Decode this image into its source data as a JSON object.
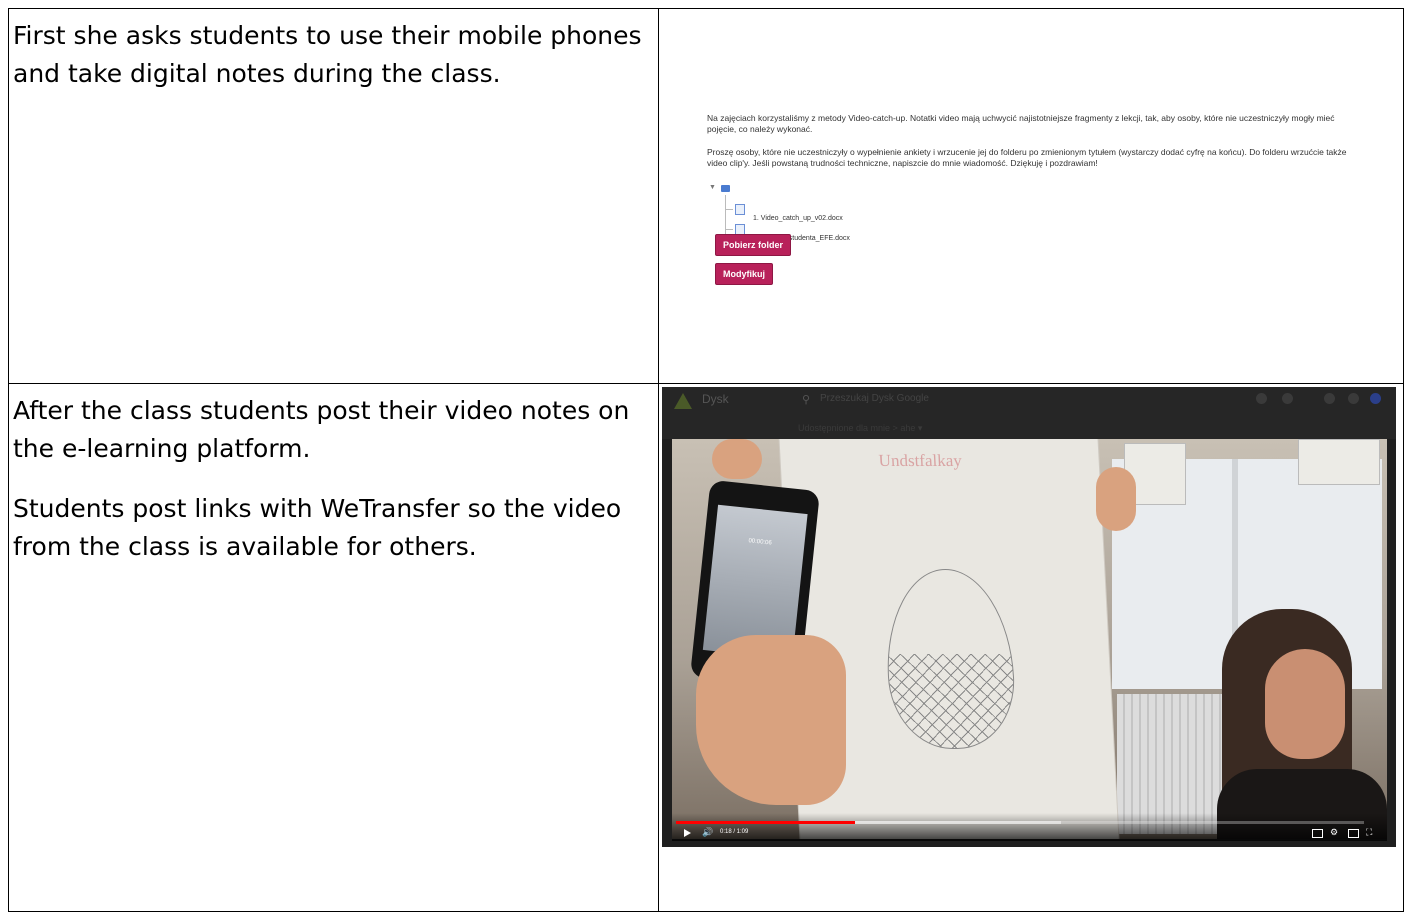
{
  "rows": [
    {
      "paragraphs": [
        "First she asks students to use their mobile phones and take digital notes during the class."
      ]
    },
    {
      "paragraphs": [
        "After the class students post their video notes on the e-learning platform.",
        "Students post links with WeTransfer  so the video from the class is available for others."
      ]
    }
  ],
  "moodle": {
    "paragraph1": "Na zajęciach korzystaliśmy z metody Video-catch-up. Notatki video mają uchwycić najistotniejsze fragmenty z lekcji, tak, aby osoby, które nie uczestniczyły mogły mieć pojęcie, co należy wykonać.",
    "paragraph2": "Proszę osoby, które nie uczestniczyły o wypełnienie ankiety i wrzucenie jej do folderu po zmienionym tytułem (wystarczy dodać cyfrę na końcu). Do folderu wrzućcie także video clip'y. Jeśli powstaną trudności techniczne, napiszcie do mnie wiadomość. Dziękuję i pozdrawiam!",
    "files": [
      "1. Video_catch_up_v02.docx",
      "ankieta dla studenta_EFE.docx"
    ],
    "download_button": "Pobierz folder",
    "edit_button": "Modyfikuj",
    "accent_color": "#b8215a"
  },
  "video": {
    "app_name": "Dysk",
    "search_placeholder": "Przeszukaj Dysk Google",
    "breadcrumb": "Udostępnione dla mnie  >  ahe ▾",
    "paper_title": "Undstfalkay",
    "recording_time": "00:00:06",
    "time_display": "0:18 / 1:09",
    "progress_played_fraction": 0.26,
    "progress_buffered_fraction": 0.56,
    "progress_color": "#ff0000"
  }
}
